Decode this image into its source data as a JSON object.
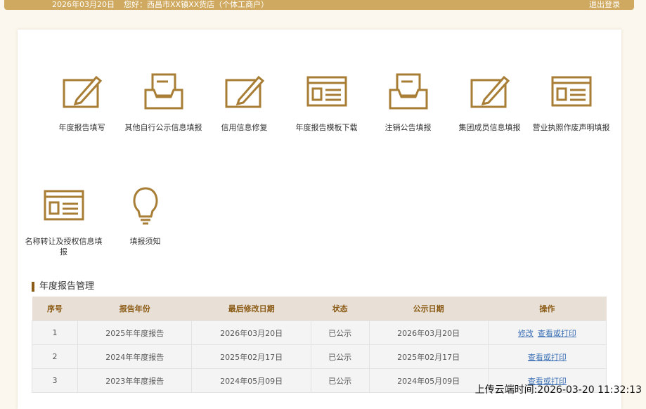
{
  "header": {
    "date": "2026年03月20日",
    "greeting": "您好：西昌市XX镇XX货店（个体工商户）",
    "logout": "退出登录"
  },
  "tiles": [
    {
      "label": "年度报告填写",
      "icon": "edit-icon"
    },
    {
      "label": "其他自行公示信息填报",
      "icon": "inbox-icon"
    },
    {
      "label": "信用信息修复",
      "icon": "edit-icon"
    },
    {
      "label": "年度报告模板下载",
      "icon": "template-icon"
    },
    {
      "label": "注销公告填报",
      "icon": "inbox-icon"
    },
    {
      "label": "集团成员信息填报",
      "icon": "edit-icon"
    },
    {
      "label": "营业执照作废声明填报",
      "icon": "template-icon"
    },
    {
      "label": "名称转让及授权信息填报",
      "icon": "template-icon"
    },
    {
      "label": "填报须知",
      "icon": "bulb-icon"
    }
  ],
  "section_title": "年度报告管理",
  "table": {
    "headers": [
      "序号",
      "报告年份",
      "最后修改日期",
      "状态",
      "公示日期",
      "操作"
    ],
    "rows": [
      {
        "no": "1",
        "year": "2025年年度报告",
        "modified": "2026年03月20日",
        "status": "已公示",
        "published": "2026年03月20日",
        "actions": [
          "修改",
          "查看或打印"
        ]
      },
      {
        "no": "2",
        "year": "2024年年度报告",
        "modified": "2025年02月17日",
        "status": "已公示",
        "published": "2025年02月17日",
        "actions": [
          "查看或打印"
        ]
      },
      {
        "no": "3",
        "year": "2023年年度报告",
        "modified": "2024年05月09日",
        "status": "已公示",
        "published": "2024年05月09日",
        "actions": [
          "查看或打印"
        ]
      }
    ]
  },
  "upload_time": "上传云端时间:2026-03-20 11:32:13",
  "colors": {
    "accent": "#cfa95f",
    "icon": "#a87d35"
  }
}
